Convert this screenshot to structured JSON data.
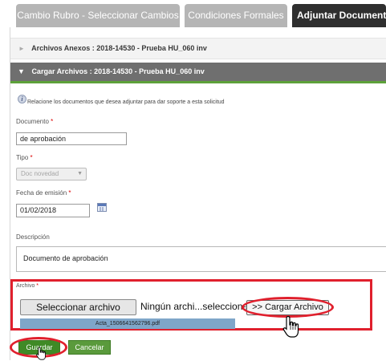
{
  "tabs": [
    {
      "label": "Cambio Rubro - Seleccionar Cambios",
      "active": false
    },
    {
      "label": "Condiciones Formales",
      "active": false
    },
    {
      "label": "Adjuntar Documento",
      "active": true
    }
  ],
  "accordion": {
    "attachments_header": "Archivos Anexos : 2018-14530 - Prueba HU_060 inv",
    "upload_header": "Cargar Archivos : 2018-14530 - Prueba HU_060 inv"
  },
  "form": {
    "info_text": "Relacione los documentos que desea adjuntar para dar soporte a esta solicitud",
    "required_mark": "*",
    "document_label": "Documento",
    "document_value": "de aprobación",
    "type_label": "Tipo",
    "type_value": "Doc novedad",
    "issue_date_label": "Fecha de emisión",
    "issue_date_value": "01/02/2018",
    "description_label": "Descripción",
    "description_value": "Documento de aprobación",
    "file_label": "Archivo",
    "file_button_label": "Seleccionar archivo",
    "file_status": "Ningún archi...seleccionado",
    "upload_button_label": ">> Cargar Archivo",
    "uploaded_file_name": "Acta_1506641562796.pdf",
    "upload_progress_percent": 100
  },
  "actions": {
    "save_label": "Guardar",
    "cancel_label": "Cancelar"
  },
  "colors": {
    "highlight_red": "#e0202d",
    "active_tab": "#2f2f2f",
    "accordion_active": "#6f6f6f",
    "accent_green": "#5da13a"
  },
  "icons": [
    "info-icon",
    "calendar-icon",
    "hand-cursor-icon",
    "chevron-right-icon",
    "chevron-down-icon"
  ]
}
